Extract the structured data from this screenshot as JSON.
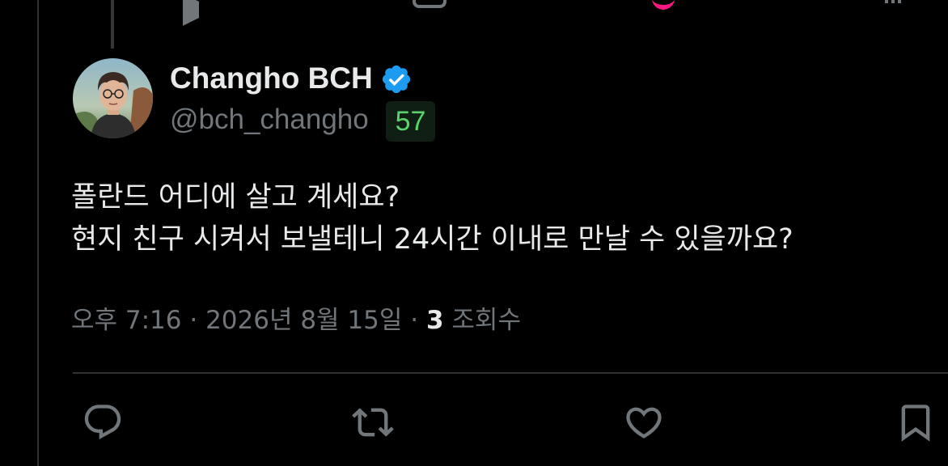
{
  "user": {
    "display_name": "Changho BCH",
    "handle": "@bch_changho",
    "badge_value": "57",
    "verified_icon": "verified-badge-icon",
    "accent_color": "#1d9bf0"
  },
  "tweet": {
    "lines": [
      "폴란드 어디에 살고 계세요?",
      "현지 친구 시켜서 보낼테니 24시간 이내로 만날 수 있을까요?"
    ]
  },
  "meta": {
    "time_date": "오후 7:16 · 2026년 8월 15일 · ",
    "views_count": "3",
    "views_label": " 조회수"
  },
  "actions": {
    "icons": [
      "reply-icon",
      "retweet-icon",
      "like-icon",
      "bookmark-icon"
    ]
  }
}
